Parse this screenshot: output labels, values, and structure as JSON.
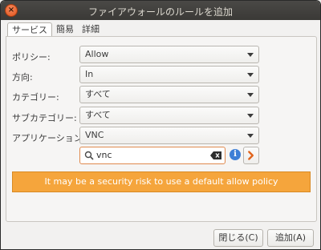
{
  "window": {
    "title": "ファイアウォールのルールを追加",
    "close_glyph": "×"
  },
  "tabs": [
    {
      "label": "サービス"
    },
    {
      "label": "簡易"
    },
    {
      "label": "詳細"
    }
  ],
  "form": {
    "policy": {
      "label": "ポリシー:",
      "value": "Allow"
    },
    "direction": {
      "label": "方向:",
      "value": "In"
    },
    "category": {
      "label": "カテゴリー:",
      "value": "すべて"
    },
    "subcategory": {
      "label": "サブカテゴリー:",
      "value": "すべて"
    },
    "application": {
      "label": "アプリケーション:",
      "value": "VNC"
    },
    "search": {
      "value": "vnc"
    },
    "info_glyph": "i"
  },
  "warning": {
    "text": "It may be a security risk to use a default allow policy",
    "color": "#f5a53c"
  },
  "buttons": {
    "close": "閉じる(C)",
    "add": "追加(A)"
  }
}
